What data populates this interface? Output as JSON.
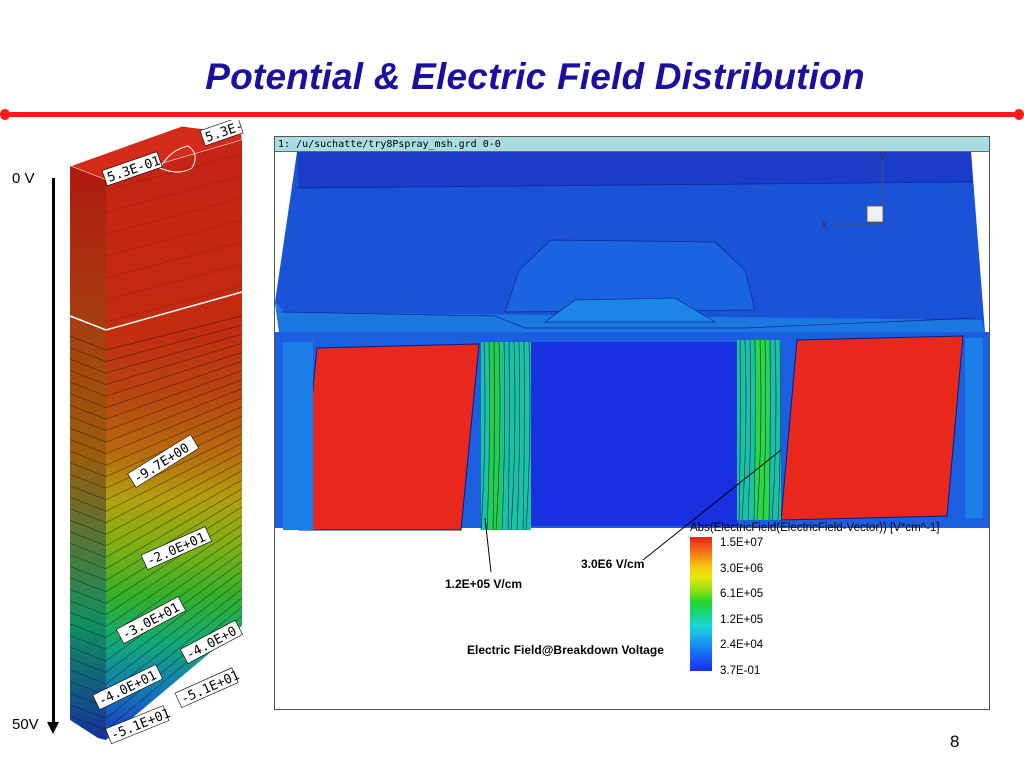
{
  "slide": {
    "title": "Potential & Electric Field Distribution",
    "page_number": "8",
    "accent_color": "#ff1a1a",
    "title_color": "#1a0fa0"
  },
  "potential_column": {
    "top_label": "0 V",
    "bottom_label": "50V",
    "contour_labels": [
      "5.3E-01",
      "5.3E-",
      "-9.7E+00",
      "-2.0E+01",
      "-3.0E+01",
      "-4.0E+0",
      "-4.0E+01",
      "-5.1E+01",
      "-5.1E+01"
    ]
  },
  "field_plot": {
    "header": "1: /u/suchatte/try8Pspray_msh.grd 0-0",
    "axis_y": "Y",
    "axis_x": "X",
    "annotations": {
      "low_field": "1.2E+05 V/cm",
      "high_field": "3.0E6 V/cm",
      "caption": "Electric Field@Breakdown Voltage"
    },
    "legend": {
      "title": "Abs(ElectricField(ElectricField-Vector)) [V*cm^-1]",
      "values": [
        "1.5E+07",
        "3.0E+06",
        "6.1E+05",
        "1.2E+05",
        "2.4E+04",
        "3.7E-01"
      ]
    }
  }
}
